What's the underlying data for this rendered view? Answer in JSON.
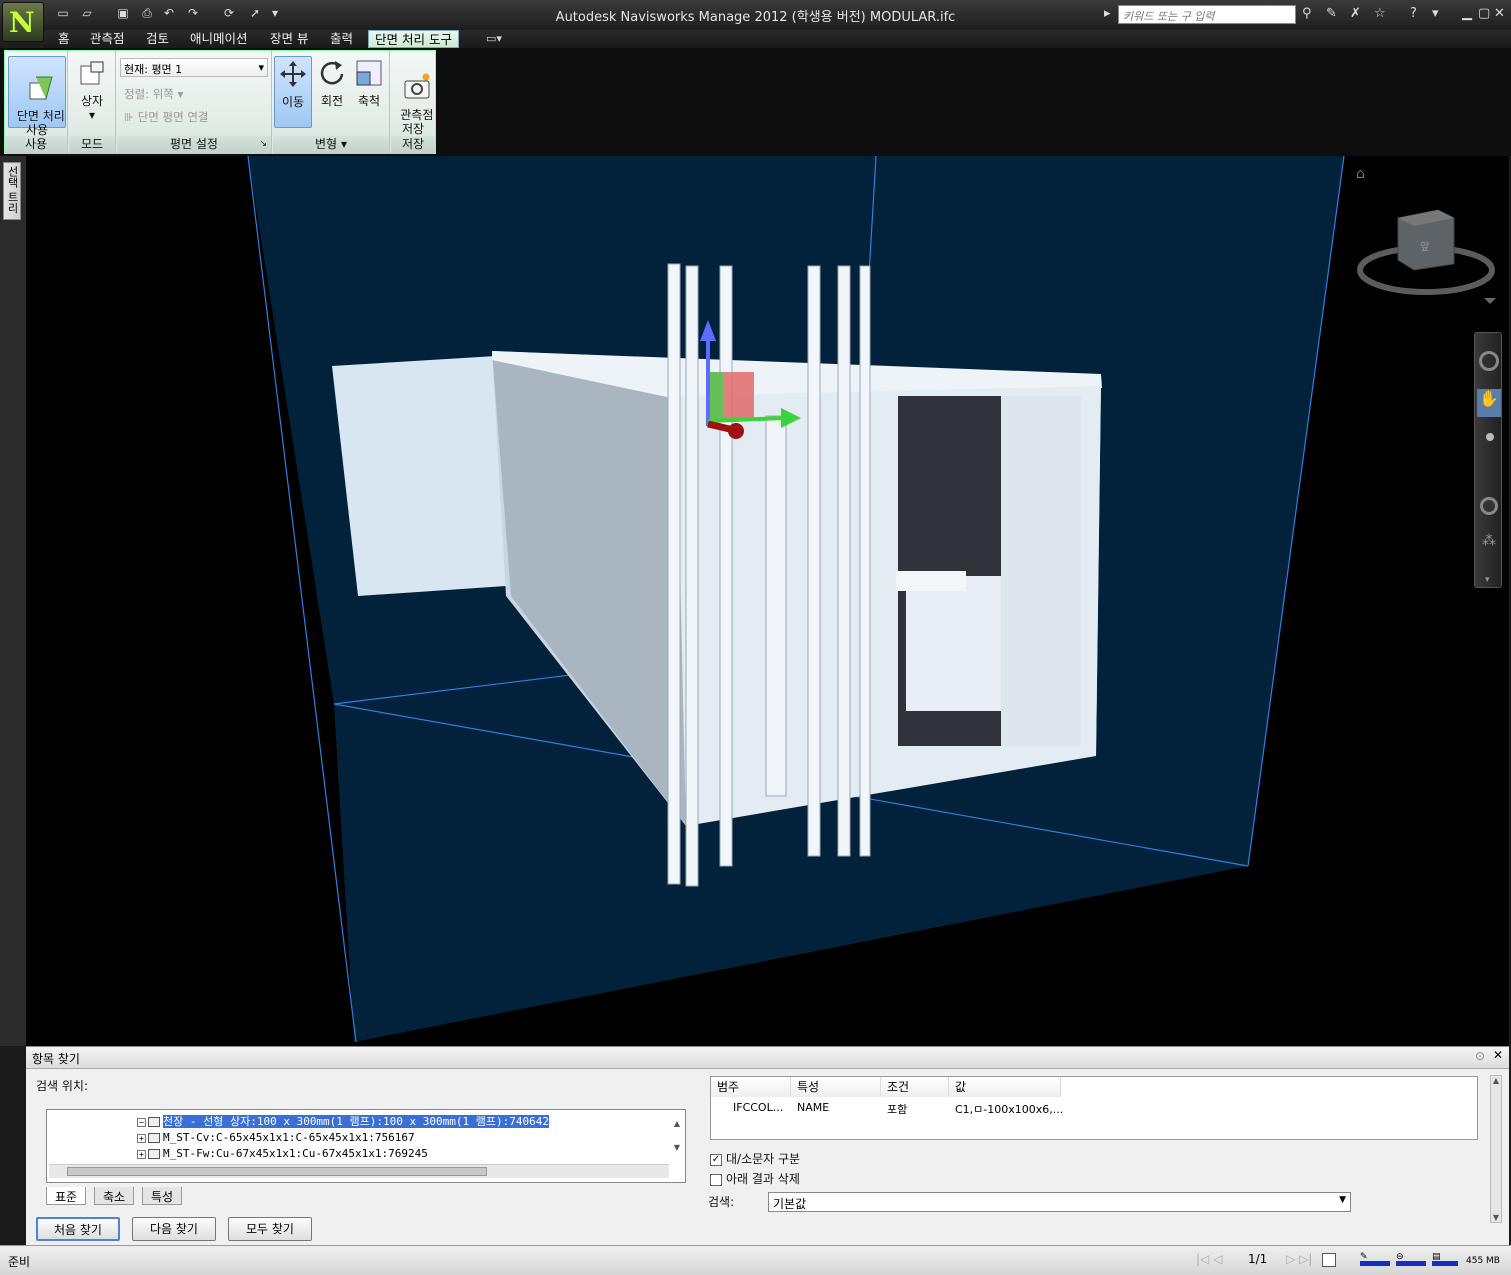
{
  "window": {
    "title": "Autodesk Navisworks Manage 2012 (학생용 버전)    MODULAR.ifc",
    "search_placeholder": "키워드 또는 구 입력",
    "app_letter": "N"
  },
  "tabs": [
    "홈",
    "관측점",
    "검토",
    "애니메이션",
    "장면 뷰",
    "출력",
    "단면 처리 도구"
  ],
  "active_tab": "단면 처리 도구",
  "ribbon": {
    "enable_label": "단면 처리\n사용",
    "box_label": "상자",
    "current_plane": "현재: 평면 1",
    "align": "정렬: 위쪽",
    "link_planes": "단면 평면 연결",
    "move": "이동",
    "rotate": "회전",
    "scale": "축척",
    "save_viewpoint": "관측점\n저장",
    "groups": [
      "사용",
      "모드",
      "평면 설정",
      "변형",
      "저장"
    ]
  },
  "side_tab": "선택 트리",
  "viewcube": {
    "front": "앞"
  },
  "find_panel": {
    "title": "항목 찾기",
    "search_in": "검색 위치:",
    "tree_rows": [
      "천장 - 선형 상자:100 x 300mm(1 램프):100 x 300mm(1 램프):740642",
      "M_ST-Cv:C-65x45x1x1:C-65x45x1x1:756167",
      "M_ST-Fw:Cu-67x45x1x1:Cu-67x45x1x1:769245"
    ],
    "tree_tabs": [
      "표준",
      "축소",
      "특성"
    ],
    "buttons": [
      "처음 찾기",
      "다음 찾기",
      "모두 찾기"
    ],
    "grid_headers": [
      "범주",
      "특성",
      "조건",
      "값"
    ],
    "grid_row": [
      "IFCCOL...",
      "NAME",
      "포함",
      "C1,ㅁ-100x100x6,..."
    ],
    "match_case": "대/소문자 구분",
    "prune_below": "아래 결과 삭제",
    "search_label": "검색:",
    "search_value": "기본값"
  },
  "status": {
    "text": "준비",
    "page": "1/1",
    "memory": "455 MB"
  },
  "colors": {
    "viewport_bg": "#000000",
    "section_box": "#00213a",
    "box_edges": "#2f7fe0",
    "model": "#dfe8f2",
    "ribbon_active": "#cfe8d6"
  }
}
